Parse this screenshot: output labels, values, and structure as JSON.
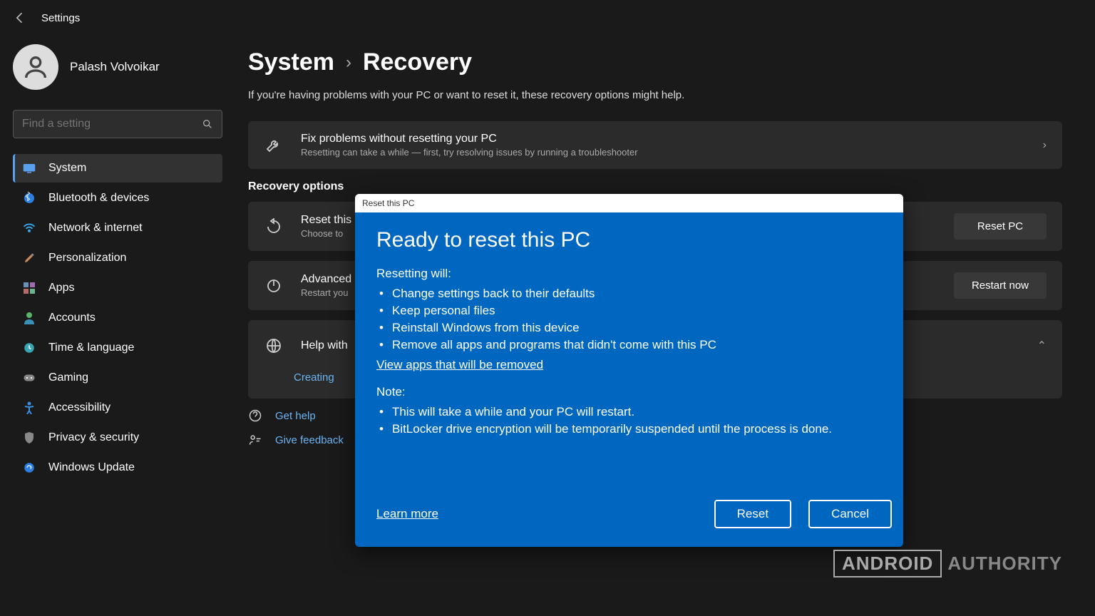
{
  "header": {
    "settings_label": "Settings"
  },
  "user": {
    "name": "Palash Volvoikar"
  },
  "search": {
    "placeholder": "Find a setting"
  },
  "sidebar": {
    "items": [
      {
        "label": "System",
        "selected": true
      },
      {
        "label": "Bluetooth & devices"
      },
      {
        "label": "Network & internet"
      },
      {
        "label": "Personalization"
      },
      {
        "label": "Apps"
      },
      {
        "label": "Accounts"
      },
      {
        "label": "Time & language"
      },
      {
        "label": "Gaming"
      },
      {
        "label": "Accessibility"
      },
      {
        "label": "Privacy & security"
      },
      {
        "label": "Windows Update"
      }
    ]
  },
  "breadcrumb": {
    "parent": "System",
    "current": "Recovery"
  },
  "subtitle": "If you're having problems with your PC or want to reset it, these recovery options might help.",
  "cards": {
    "fix": {
      "title": "Fix problems without resetting your PC",
      "desc": "Resetting can take a while — first, try resolving issues by running a troubleshooter"
    },
    "recovery_heading": "Recovery options",
    "reset": {
      "title": "Reset this",
      "desc": "Choose to",
      "button": "Reset PC"
    },
    "advanced": {
      "title": "Advanced",
      "desc": "Restart you",
      "button": "Restart now"
    },
    "help": {
      "title": "Help with",
      "link": "Creating"
    }
  },
  "footer_links": {
    "get_help": "Get help",
    "give_feedback": "Give feedback"
  },
  "dialog": {
    "titlebar": "Reset this PC",
    "heading": "Ready to reset this PC",
    "resetting_label": "Resetting will:",
    "resetting_items": [
      "Change settings back to their defaults",
      "Keep personal files",
      "Reinstall Windows from this device",
      "Remove all apps and programs that didn't come with this PC"
    ],
    "view_apps_link": "View apps that will be removed",
    "note_label": "Note:",
    "note_items": [
      "This will take a while and your PC will restart.",
      "BitLocker drive encryption will be temporarily suspended until the process is done."
    ],
    "learn_more": "Learn more",
    "reset_button": "Reset",
    "cancel_button": "Cancel"
  },
  "watermark": {
    "box": "ANDROID",
    "text": "AUTHORITY"
  }
}
